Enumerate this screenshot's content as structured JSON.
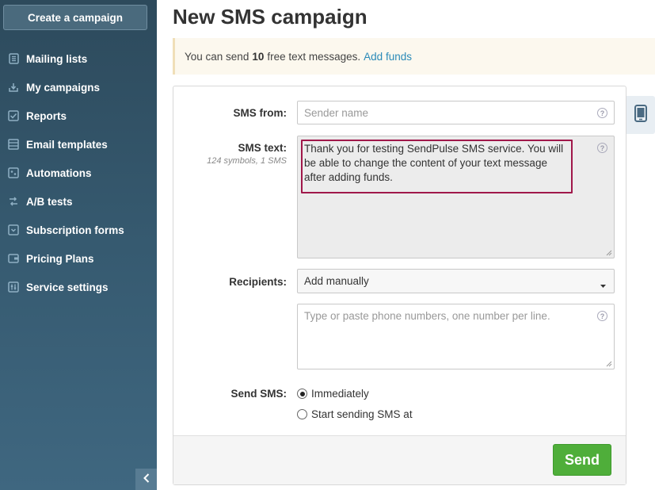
{
  "sidebar": {
    "create_label": "Create a campaign",
    "items": [
      {
        "label": "Mailing lists",
        "icon": "mailing-lists-icon"
      },
      {
        "label": "My campaigns",
        "icon": "campaigns-icon"
      },
      {
        "label": "Reports",
        "icon": "reports-icon"
      },
      {
        "label": "Email templates",
        "icon": "templates-icon"
      },
      {
        "label": "Automations",
        "icon": "automations-icon"
      },
      {
        "label": "A/B tests",
        "icon": "ab-tests-icon"
      },
      {
        "label": "Subscription forms",
        "icon": "forms-icon"
      },
      {
        "label": "Pricing Plans",
        "icon": "wallet-icon"
      },
      {
        "label": "Service settings",
        "icon": "settings-icon"
      }
    ]
  },
  "page": {
    "title": "New SMS campaign"
  },
  "notice": {
    "prefix": "You can send",
    "count": "10",
    "suffix": "free text messages.",
    "link": "Add funds"
  },
  "form": {
    "sms_from_label": "SMS from:",
    "sms_from_placeholder": "Sender name",
    "sms_text_label": "SMS text:",
    "sms_text_meta": "124 symbols, 1 SMS",
    "sms_text_value": "Thank you for testing SendPulse SMS service. You will be able to change the content of your text message after adding funds.",
    "recipients_label": "Recipients:",
    "recipients_selected": "Add manually",
    "phones_placeholder": "Type or paste phone numbers, one number per line.",
    "send_label": "Send SMS:",
    "send_options": [
      "Immediately",
      "Start sending SMS at"
    ],
    "send_selected": "Immediately"
  },
  "footer": {
    "send_button": "Send"
  },
  "colors": {
    "accent": "#2a8ab8",
    "send": "#4fae3a",
    "highlight": "#a0184a",
    "sidebar": "#365a70"
  }
}
